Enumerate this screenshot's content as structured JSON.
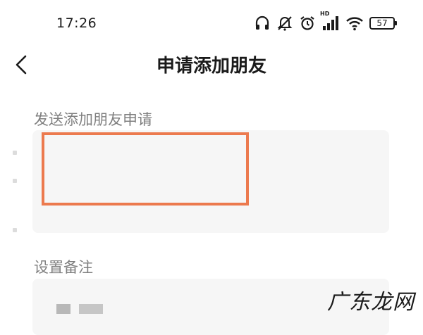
{
  "status_bar": {
    "time": "17:26",
    "battery_level": "57",
    "hd_badge": "HD",
    "icons": [
      "headphones-icon",
      "mute-icon",
      "alarm-icon",
      "cellular-signal-icon",
      "wifi-icon",
      "battery-icon"
    ]
  },
  "nav": {
    "back_icon": "chevron-left-icon",
    "title": "申请添加朋友"
  },
  "form": {
    "request_label": "发送添加朋友申请",
    "request_value": "",
    "remark_label": "设置备注",
    "highlight_color": "#ec7a4e"
  },
  "watermark": "广东龙网"
}
